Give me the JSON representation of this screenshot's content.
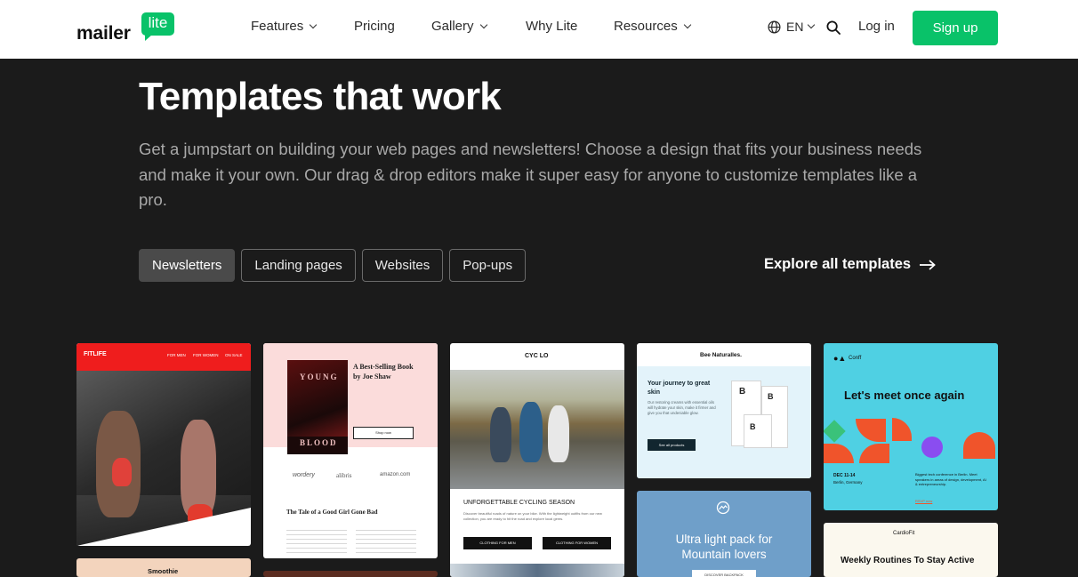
{
  "header": {
    "logo_word": "mailer",
    "logo_badge": "lite",
    "nav": [
      {
        "label": "Features",
        "dropdown": true
      },
      {
        "label": "Pricing",
        "dropdown": false
      },
      {
        "label": "Gallery",
        "dropdown": true
      },
      {
        "label": "Why Lite",
        "dropdown": false
      },
      {
        "label": "Resources",
        "dropdown": true
      }
    ],
    "language": "EN",
    "login_label": "Log in",
    "signup_label": "Sign up"
  },
  "hero": {
    "title": "Templates that work",
    "description": "Get a jumpstart on building your web pages and newsletters! Choose a design that fits your business needs and make it your own. Our drag & drop editors make it super easy for anyone to customize templates like a pro."
  },
  "tabs": [
    {
      "label": "Newsletters",
      "active": true
    },
    {
      "label": "Landing pages",
      "active": false
    },
    {
      "label": "Websites",
      "active": false
    },
    {
      "label": "Pop-ups",
      "active": false
    }
  ],
  "explore_label": "Explore all templates",
  "cards": {
    "fitlife": {
      "brand": "FITLIFE",
      "links": [
        "FOR MEN",
        "FOR WOMEN",
        "ON SALE"
      ]
    },
    "book": {
      "headline": "A Best-Selling Book by Joe Shaw",
      "cover_top": "YOUNG",
      "cover_bottom": "BLOOD",
      "button": "Shop now",
      "logos": [
        "wordery",
        "alibris",
        "amazon.com"
      ],
      "subtitle": "The Tale of a Good Girl Gone Bad"
    },
    "cyclo": {
      "brand": "CYC LO",
      "headline": "UNFORGETTABLE CYCLING SEASON",
      "body": "Discover beautiful roads of nature on your bike. With the lightweight outfits from our new collection, you are ready to hit the road and explore local gems.",
      "btn_men": "CLOTHING FOR MEN",
      "btn_women": "CLOTHING FOR WOMEN"
    },
    "bee": {
      "brand": "Bee Naturalles.",
      "headline": "Your journey to great skin",
      "body": "Our restoring creams with essential oils will hydrate your skin, make it firmer and give you that undeniable glow.",
      "button": "See all products",
      "box_letter": "B"
    },
    "ultra": {
      "headline": "Ultra light pack for Mountain lovers",
      "button": "DISCOVER BACKPACK"
    },
    "conf": {
      "brand": "Conff",
      "headline": "Let's meet once again",
      "date": "DEC 11-14",
      "location": "Berlin, Germany",
      "info": "Biggest tech conference in Berlin. Meet speakers in areas of design, development, AI & entrepreneurship.",
      "link": "RSVP now"
    },
    "cardio": {
      "brand": "CardioFit",
      "headline": "Weekly Routines To Stay Active"
    },
    "smoothie": {
      "brand": "Smoothie"
    }
  },
  "colors": {
    "brand_green": "#09c269",
    "background": "#1b1b1b",
    "header_bg": "#ffffff"
  },
  "icons": [
    "globe-icon",
    "search-icon",
    "chevron-down-icon",
    "arrow-right-icon"
  ]
}
